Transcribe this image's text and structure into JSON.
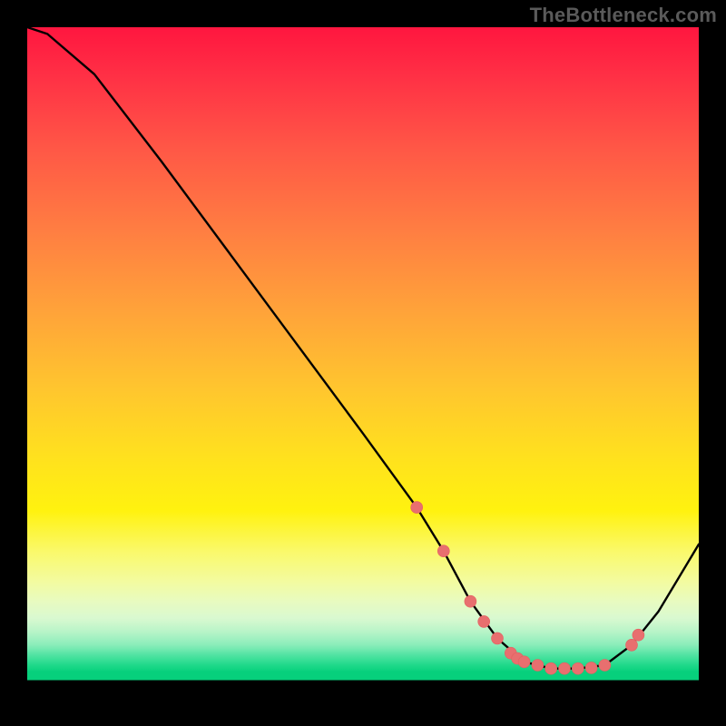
{
  "attribution": "TheBottleneck.com",
  "colors": {
    "dot": "#e86f6f",
    "curve": "#000000",
    "top": "#ff163f",
    "bottom_band": "#07d07c",
    "frame": "#000000"
  },
  "chart_data": {
    "type": "line",
    "title": "",
    "xlabel": "",
    "ylabel": "",
    "xlim": [
      0,
      100
    ],
    "ylim": [
      0,
      100
    ],
    "x": [
      0,
      3,
      10,
      20,
      30,
      40,
      50,
      58,
      62,
      66,
      70,
      74,
      78,
      82,
      86,
      90,
      94,
      100
    ],
    "y": [
      100,
      99,
      93,
      80,
      66.5,
      53,
      39.5,
      28.5,
      22,
      14.5,
      9,
      5.5,
      4.5,
      4.5,
      5,
      8,
      13,
      23
    ],
    "markers_x": [
      58,
      62,
      66,
      68,
      70,
      72,
      73,
      74,
      76,
      78,
      80,
      82,
      84,
      86,
      90,
      91
    ],
    "markers_y": [
      28.5,
      22,
      14.5,
      11.5,
      9,
      6.8,
      6,
      5.5,
      5,
      4.5,
      4.5,
      4.5,
      4.6,
      5,
      8,
      9.5
    ],
    "annotations": []
  }
}
